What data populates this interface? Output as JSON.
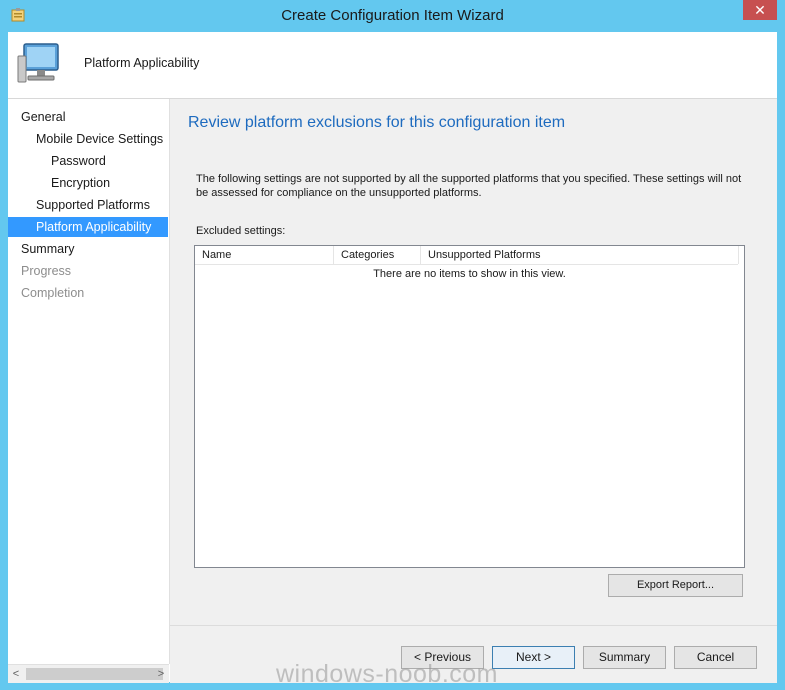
{
  "window": {
    "title": "Create Configuration Item Wizard",
    "close_label": "✕"
  },
  "header": {
    "title": "Platform Applicability"
  },
  "nav": {
    "items": [
      {
        "label": "General",
        "state": "normal"
      },
      {
        "label": "Mobile Device Settings",
        "state": "normal"
      },
      {
        "label": "Password",
        "state": "normal"
      },
      {
        "label": "Encryption",
        "state": "normal"
      },
      {
        "label": "Supported Platforms",
        "state": "normal"
      },
      {
        "label": "Platform Applicability",
        "state": "active"
      },
      {
        "label": "Summary",
        "state": "normal"
      },
      {
        "label": "Progress",
        "state": "muted"
      },
      {
        "label": "Completion",
        "state": "muted"
      }
    ],
    "scroll_left": "<",
    "scroll_right": ">"
  },
  "main": {
    "heading": "Review platform exclusions for this configuration item",
    "description": "The following settings are not supported by all the supported platforms that you specified. These settings will not be assessed for compliance on the unsupported platforms.",
    "excluded_label": "Excluded settings:",
    "columns": [
      "Name",
      "Categories",
      "Unsupported Platforms"
    ],
    "empty_text": "There are no items to show in this view.",
    "export_button": "Export Report..."
  },
  "footer": {
    "previous": "< Previous",
    "next": "Next >",
    "summary": "Summary",
    "cancel": "Cancel"
  },
  "watermark": "windows-noob.com",
  "colors": {
    "titlebar": "#63c8ef",
    "heading": "#1e6bbf",
    "selection": "#3399ff"
  }
}
